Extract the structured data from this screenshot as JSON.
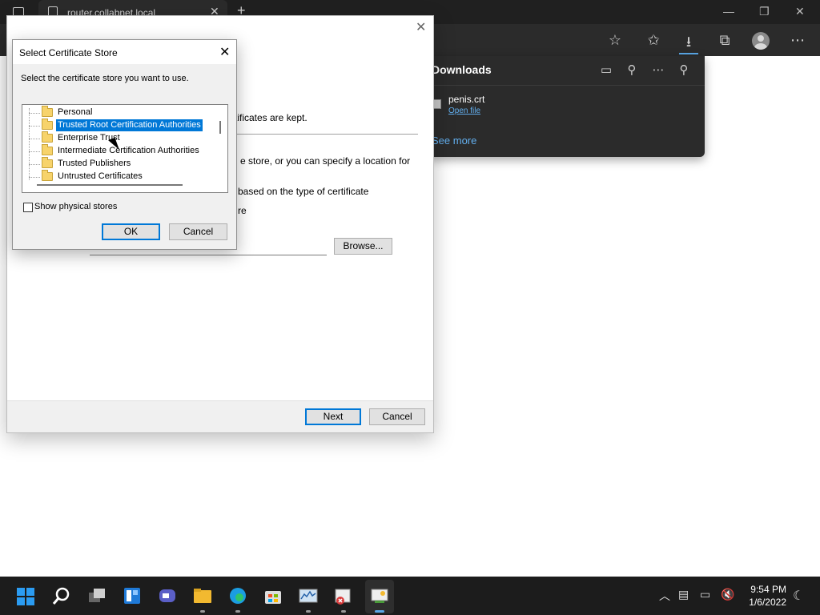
{
  "browser": {
    "tab_title": "router.collabnet.local",
    "tab_close": "✕",
    "new_tab": "+",
    "window_controls": {
      "minimize": "—",
      "restore": "❐",
      "close": "✕"
    },
    "toolbar_icons": [
      "favorite-add-icon",
      "favorites-icon",
      "downloads-icon",
      "collections-icon",
      "profile-icon",
      "more-icon"
    ]
  },
  "downloads": {
    "title": "Downloads",
    "file_name": "penis.crt",
    "open_file": "Open file",
    "see_more": "See more"
  },
  "wizard": {
    "close": "✕",
    "text_kept": "rtificates are kept.",
    "text_store_1": "e store, or you can specify a location for",
    "text_based": "based on the type of certificate",
    "text_re": "re",
    "browse_label": "Browse...",
    "next_label": "Next",
    "cancel_label": "Cancel"
  },
  "store_dialog": {
    "title": "Select Certificate Store",
    "close": "✕",
    "instruction": "Select the certificate store you want to use.",
    "items": [
      "Personal",
      "Trusted Root Certification Authorities",
      "Enterprise Trust",
      "Intermediate Certification Authorities",
      "Trusted Publishers",
      "Untrusted Certificates"
    ],
    "selected_index": 1,
    "show_physical_label": "Show physical stores",
    "show_physical_checked": false,
    "ok_label": "OK",
    "cancel_label": "Cancel"
  },
  "taskbar": {
    "time": "9:54 PM",
    "date": "1/6/2022"
  }
}
